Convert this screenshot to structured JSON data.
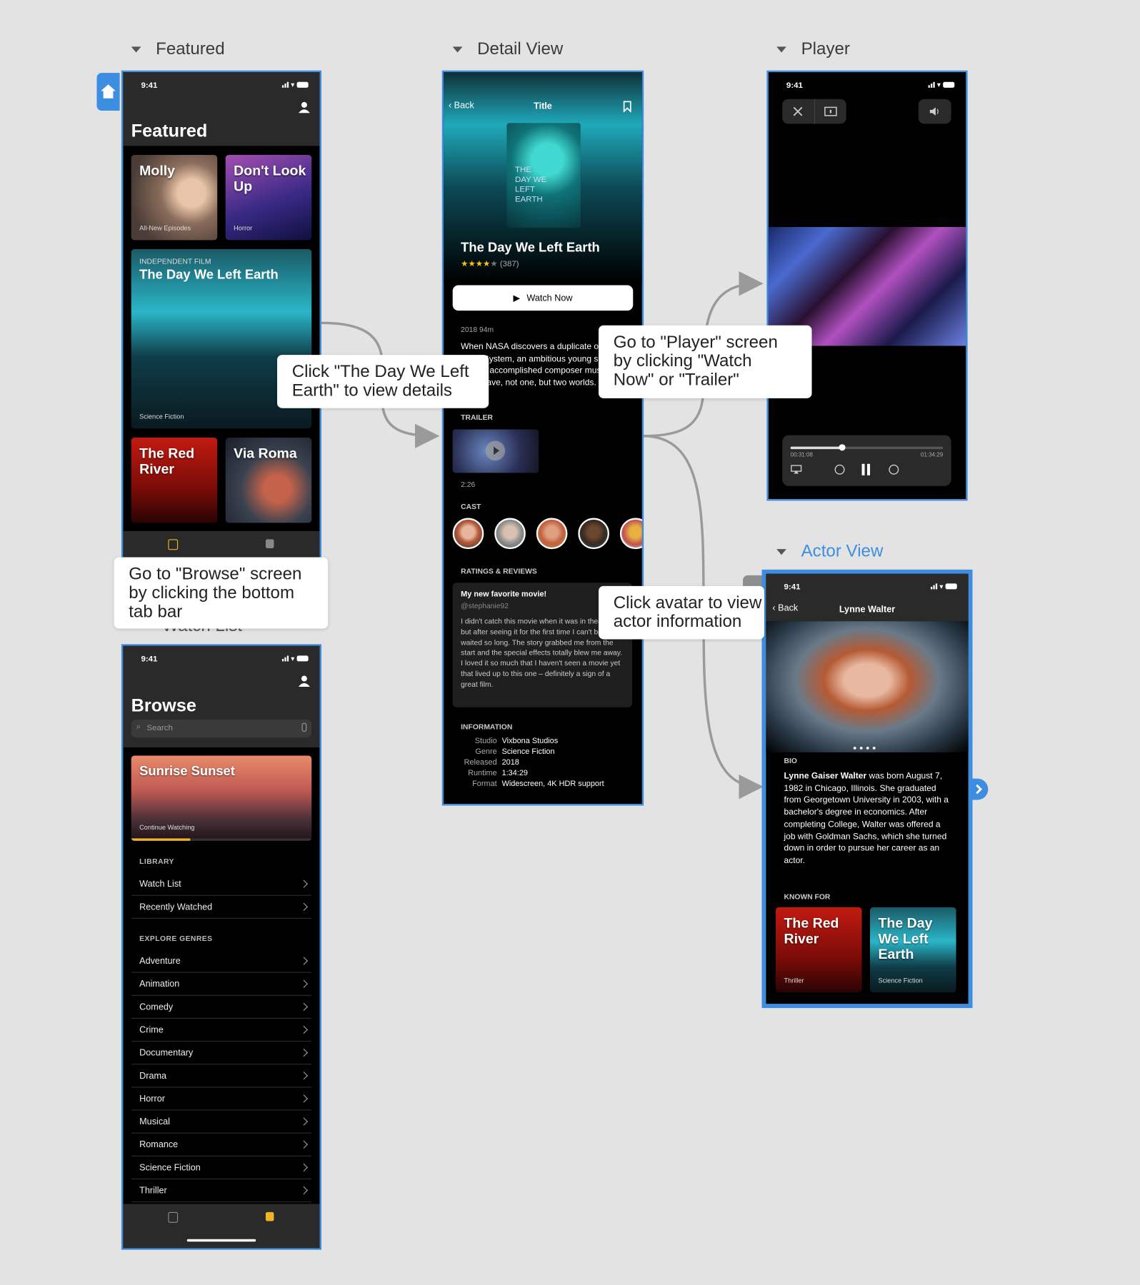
{
  "sections": {
    "featured": "Featured",
    "detail": "Detail View",
    "player": "Player",
    "actor": "Actor View"
  },
  "status_time": "9:41",
  "featured": {
    "title": "Featured",
    "cards": [
      {
        "title": "Molly",
        "sub": "All-New Episodes"
      },
      {
        "title": "Don't Look Up",
        "sub": "Horror"
      },
      {
        "kicker": "INDEPENDENT FILM",
        "title": "The Day We Left Earth",
        "sub": "Science Fiction"
      },
      {
        "title": "The Red River",
        "sub": ""
      },
      {
        "title": "Via Roma",
        "sub": ""
      }
    ]
  },
  "callouts": {
    "details": "Click \"The Day We Left Earth\" to view details",
    "player": "Go to \"Player\" screen by clicking \"Watch Now\" or \"Trailer\"",
    "browse": "Go to \"Browse\" screen by clicking the bottom tab bar",
    "actor": "Click avatar to view actor information"
  },
  "behind_text": "Watch List",
  "browse": {
    "title": "Browse",
    "search_placeholder": "Search",
    "hero_title": "Sunrise Sunset",
    "hero_sub": "Continue Watching",
    "library_label": "LIBRARY",
    "library": [
      "Watch List",
      "Recently Watched"
    ],
    "genres_label": "EXPLORE GENRES",
    "genres": [
      "Adventure",
      "Animation",
      "Comedy",
      "Crime",
      "Documentary",
      "Drama",
      "Horror",
      "Musical",
      "Romance",
      "Science Fiction",
      "Thriller"
    ]
  },
  "detail": {
    "back": "Back",
    "nav_title": "Title",
    "poster_text": "THE DAY WE LEFT EARTH",
    "movie_title": "The Day We Left Earth",
    "rating": 4,
    "rating_count": "(387)",
    "watch_now": "Watch Now",
    "meta": "2018   94m",
    "synopsis": "When NASA discovers a duplicate of our Solar System, an ambitious young scientist and an accomplished composer must team up to save, not one, but two worlds.",
    "trailer_label": "TRAILER",
    "trailer_duration": "2:26",
    "cast_label": "CAST",
    "reviews_label": "RATINGS & REVIEWS",
    "review": {
      "title": "My new favorite movie!",
      "user": "@stephanie92",
      "body": "I didn't catch this movie when it was in theaters but after seeing it for the first time I can't believe I waited so long. The story grabbed me from the start and the special effects totally blew me away. I loved it so much that I haven't seen a movie yet that lived up to this one – definitely a sign of a great film."
    },
    "info_label": "INFORMATION",
    "info": [
      {
        "k": "Studio",
        "v": "Vixbona Studios"
      },
      {
        "k": "Genre",
        "v": "Science Fiction"
      },
      {
        "k": "Released",
        "v": "2018"
      },
      {
        "k": "Runtime",
        "v": "1:34:29"
      },
      {
        "k": "Format",
        "v": "Widescreen, 4K HDR support"
      }
    ]
  },
  "player": {
    "elapsed": "00:31:08",
    "total": "01:34:29",
    "progress": 0.33
  },
  "actor": {
    "back": "Back",
    "name": "Lynne Walter",
    "bio_label": "BIO",
    "bio_name": "Lynne Gaiser Walter",
    "bio_rest": " was born August 7, 1982 in Chicago, Illinois. She graduated from Georgetown University in 2003, with a bachelor's degree in economics. After completing College, Walter was offered a job with Goldman Sachs, which she turned down in order to pursue her career as an actor.",
    "known_label": "KNOWN FOR",
    "known": [
      {
        "title": "The Red River",
        "sub": "Thriller"
      },
      {
        "title": "The Day We Left Earth",
        "sub": "Science Fiction"
      }
    ]
  },
  "colors": {
    "accent": "#3d8ee0",
    "tab_active": "#f0b429",
    "star": "#f5c518"
  }
}
